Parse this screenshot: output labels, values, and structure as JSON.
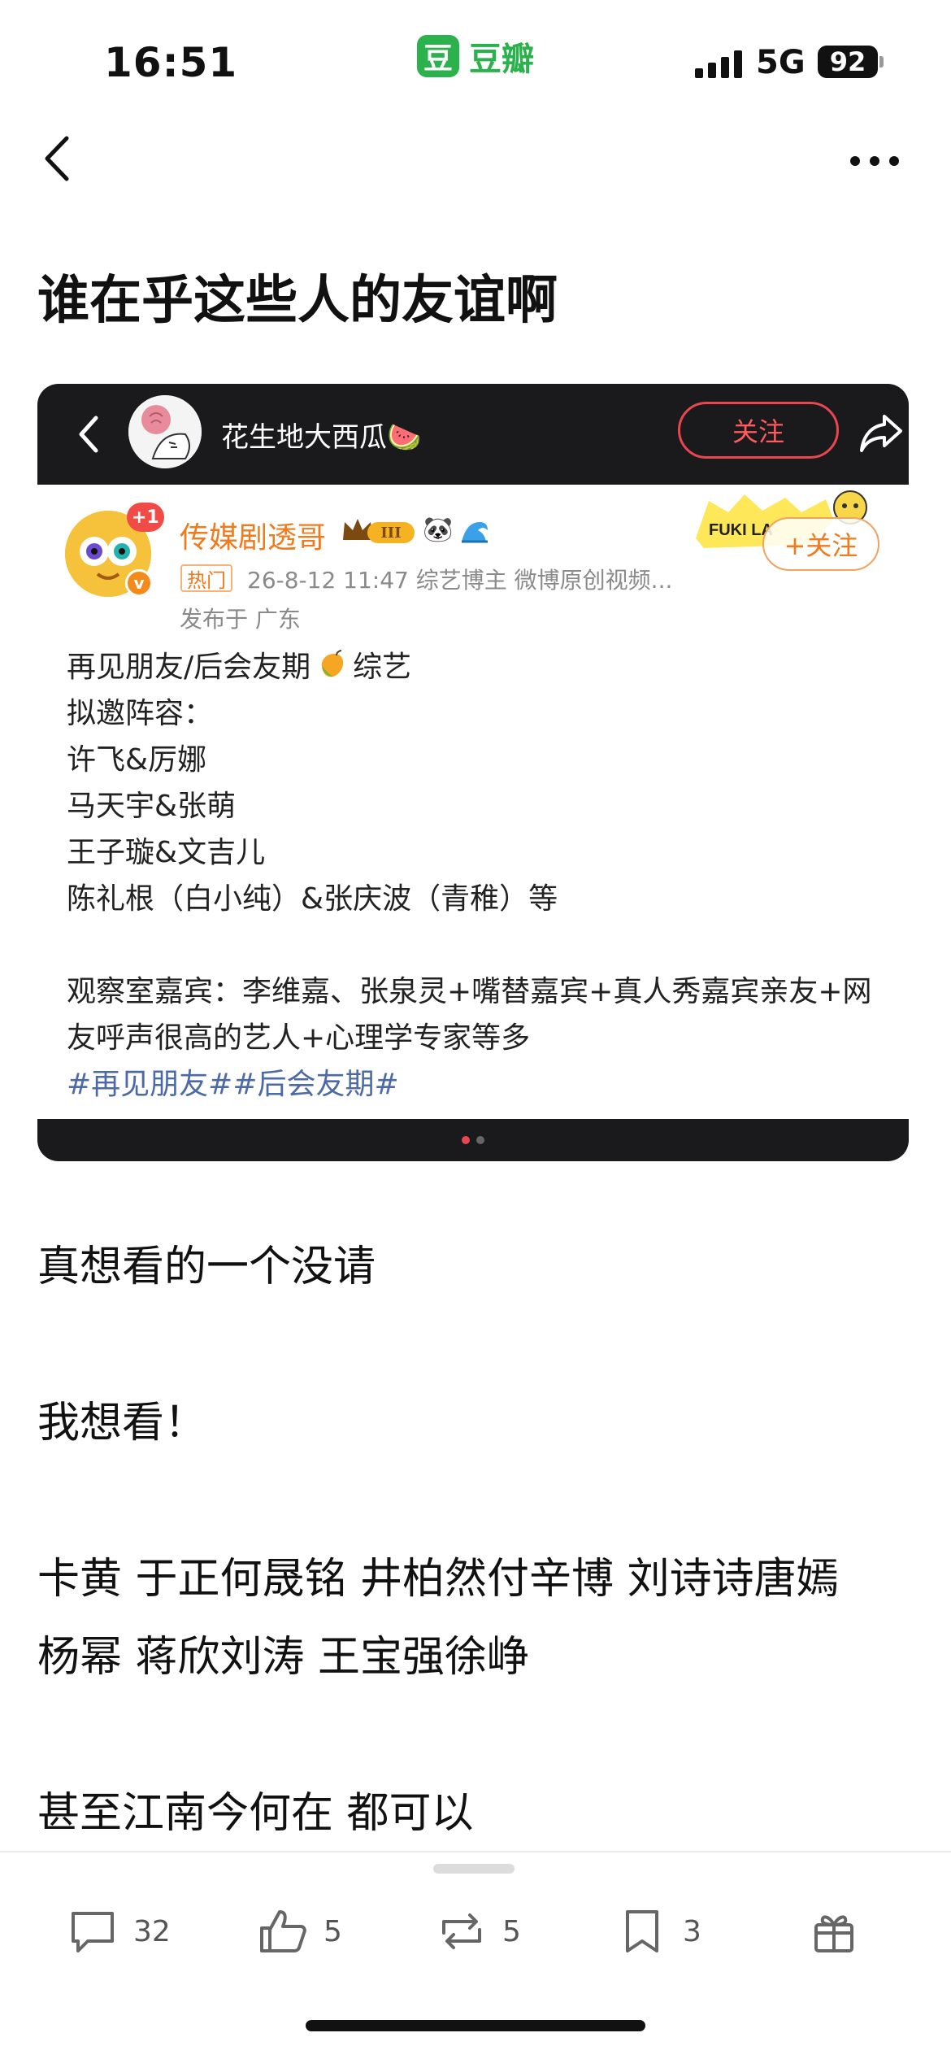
{
  "status_bar": {
    "time": "16:51",
    "app_logo_glyph": "豆",
    "app_name": "豆瓣",
    "network": "5G",
    "battery": "92",
    "accent": "#2bb24c"
  },
  "nav": {
    "back_icon": "chevron-left-icon",
    "more_icon": "more-dots-icon"
  },
  "post": {
    "title": "谁在乎这些人的友谊啊",
    "body": [
      "真想看的一个没请",
      "",
      "我想看！",
      "",
      "卡黄 于正何晟铭 井柏然付辛博 刘诗诗唐嫣",
      "杨幂 蒋欣刘涛 王宝强徐峥",
      "",
      "甚至江南今何在 都可以"
    ]
  },
  "embedded_card": {
    "top_bar": {
      "username": "花生地大西瓜🍉",
      "follow_label": "关注",
      "share_icon": "share-icon"
    },
    "weibo": {
      "author": "传媒剧透哥",
      "avatar_badge": "+1",
      "verified_badge": "v",
      "level_badge": "III",
      "panda": "🐼",
      "hot_tag": "热门",
      "meta": "26-8-12 11:47  综艺博主 微博原创视频...",
      "location": "发布于 广东",
      "sticker_text": "FUKI LA",
      "follow_label": "+关注",
      "content": {
        "line1_before": "再见朋友/后会友期",
        "line1_after": "综艺",
        "lines": [
          "拟邀阵容：",
          "许飞&厉娜",
          "马天宇&张萌",
          "王子璇&文吉儿",
          "陈礼根（白小纯）&张庆波（青稚）等",
          "",
          "观察室嘉宾：李维嘉、张泉灵+嘴替嘉宾+真人秀嘉宾亲友+网友呼声很高的艺人+心理学专家等多"
        ],
        "hashtags": "#再见朋友##后会友期#"
      }
    },
    "pager": {
      "total": 2,
      "active": 1
    }
  },
  "toolbar": {
    "comments": "32",
    "likes": "5",
    "reposts": "5",
    "collects": "3"
  }
}
